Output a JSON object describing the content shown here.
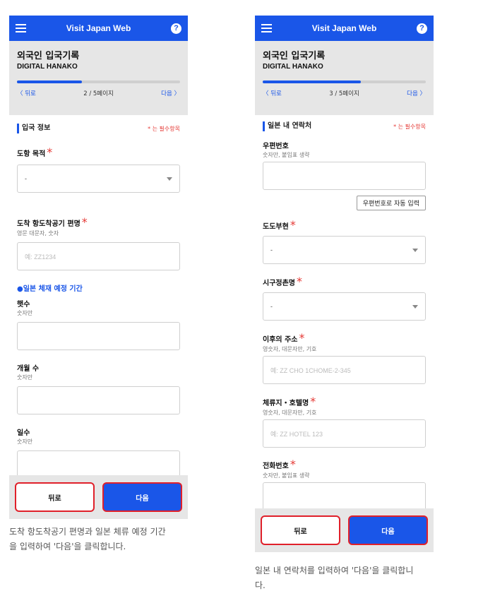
{
  "app": {
    "title": "Visit Japan Web",
    "help_icon": "?"
  },
  "colors": {
    "accent": "#1a56e8",
    "required": "#e53935",
    "highlight": "#e0202a"
  },
  "left": {
    "header": {
      "title": "외국인 입국기록",
      "name": "DIGITAL HANAKO",
      "progress_fraction": 0.4
    },
    "pager": {
      "back": "〈 뒤로",
      "count": "2 / 5페이지",
      "next": "다음 〉"
    },
    "section": {
      "title": "입국 정보",
      "required_note": "* 는 필수항목"
    },
    "purpose": {
      "label": "도항 목적",
      "req": "*",
      "value": "-"
    },
    "flight": {
      "label": "도착 항도착공기 편명",
      "req": "*",
      "hint": "영문 대문자, 숫자",
      "placeholder": "예: ZZ1234"
    },
    "period": {
      "title": "●일본 체재 예정 기간"
    },
    "years": {
      "label": "햇수",
      "hint": "숫자만"
    },
    "months": {
      "label": "개월 수",
      "hint": "숫자만"
    },
    "days": {
      "label": "일수",
      "hint": "숫자만"
    },
    "buttons": {
      "back": "뒤로",
      "next": "다음"
    },
    "caption": [
      "도착 항도착공기 편명과 일본 체류 예정 기간",
      "을 입력하여 '다음'을 클릭합니다."
    ]
  },
  "right": {
    "header": {
      "title": "외국인 입국기록",
      "name": "DIGITAL HANAKO",
      "progress_fraction": 0.6
    },
    "pager": {
      "back": "〈 뒤로",
      "count": "3 / 5페이지",
      "next": "다음 〉"
    },
    "section": {
      "title": "일본 내 연락처",
      "required_note": "* 는 필수항목"
    },
    "postal": {
      "label": "우편번호",
      "hint": "숫자만, 붙임표 생략",
      "auto_button": "우편번호로 자동 입력"
    },
    "prefecture": {
      "label": "도도부현",
      "req": "*",
      "value": "-"
    },
    "city": {
      "label": "시구정촌명",
      "req": "*",
      "value": "-"
    },
    "address": {
      "label": "이후의 주소",
      "req": "*",
      "hint": "영숫자, 대문자만, 기호",
      "placeholder": "예: ZZ CHO 1CHOME-2-345"
    },
    "hotel": {
      "label": "체류지・호텔명",
      "req": "*",
      "hint": "영숫자, 대문자만, 기호",
      "placeholder": "예: ZZ HOTEL 123"
    },
    "phone": {
      "label": "전화번호",
      "req": "*",
      "hint": "숫자만, 붙임표 생략"
    },
    "buttons": {
      "back": "뒤로",
      "next": "다음"
    },
    "caption": [
      "일본 내 연락처를 입력하여 '다음'을 클릭합니",
      "다."
    ]
  }
}
